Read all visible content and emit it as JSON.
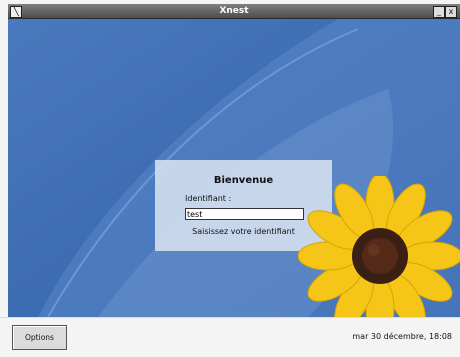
{
  "window": {
    "title": "Xnest",
    "system_icon": "x-window-icon",
    "minimize_glyph": "_",
    "close_glyph": "x"
  },
  "login": {
    "welcome": "Bienvenue",
    "field_label": "Identifiant :",
    "username_value": "test",
    "hint": "Saisissez votre identifiant"
  },
  "bottom": {
    "options_label": "Options",
    "datetime": "mar 30 décembre, 18:08"
  },
  "colors": {
    "desktop_blue": "#3f6db2",
    "petal_yellow": "#f5c518",
    "flower_center": "#3a1f14"
  }
}
